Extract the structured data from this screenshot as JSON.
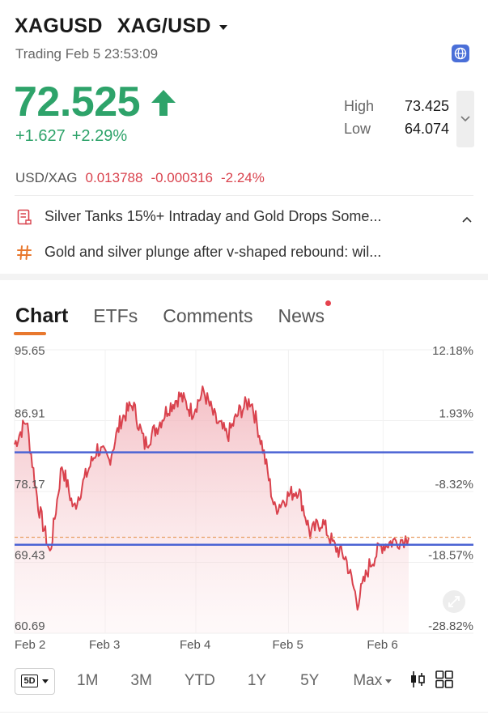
{
  "header": {
    "symbol": "XAGUSD",
    "pair": "XAG/USD",
    "status": "Trading Feb 5 23:53:09"
  },
  "quote": {
    "price": "72.525",
    "change": "+1.627",
    "change_pct": "+2.29%",
    "high_label": "High",
    "high": "73.425",
    "low_label": "Low",
    "low": "64.074"
  },
  "cross": {
    "label": "USD/XAG",
    "value": "0.013788",
    "change": "-0.000316",
    "change_pct": "-2.24%"
  },
  "news": [
    {
      "icon": "document-icon",
      "text": "Silver Tanks 15%+ Intraday and Gold Drops Some..."
    },
    {
      "icon": "hashtag-icon",
      "text": "Gold and silver plunge after v-shaped rebound: wil..."
    }
  ],
  "tabs": [
    {
      "label": "Chart",
      "active": true
    },
    {
      "label": "ETFs",
      "active": false
    },
    {
      "label": "Comments",
      "active": false
    },
    {
      "label": "News",
      "active": false,
      "dot": true
    }
  ],
  "chart_data": {
    "type": "area",
    "y_left_ticks": [
      "95.65",
      "86.91",
      "78.17",
      "69.43",
      "60.69"
    ],
    "y_right_ticks": [
      "12.18%",
      "1.93%",
      "-8.32%",
      "-18.57%",
      "-28.82%"
    ],
    "x_ticks": [
      "Feb 2",
      "Feb 3",
      "Feb 4",
      "Feb 5",
      "Feb 6"
    ],
    "ylim": [
      60.69,
      95.65
    ],
    "x": [
      0,
      0.03,
      0.06,
      0.09,
      0.12,
      0.15,
      0.18,
      0.21,
      0.24,
      0.27,
      0.3,
      0.33,
      0.36,
      0.39,
      0.42,
      0.45,
      0.48,
      0.51,
      0.54,
      0.57,
      0.6,
      0.63,
      0.66,
      0.69,
      0.72,
      0.75,
      0.78,
      0.81,
      0.84,
      0.87,
      0.9,
      0.93,
      0.96,
      1.0
    ],
    "values": [
      84.0,
      87.0,
      76.5,
      70.5,
      81.5,
      76.0,
      80.0,
      83.5,
      82.0,
      87.0,
      89.0,
      84.0,
      86.0,
      88.5,
      90.0,
      88.0,
      90.5,
      87.0,
      85.0,
      88.0,
      89.5,
      83.5,
      76.0,
      77.5,
      78.5,
      73.0,
      74.5,
      71.5,
      70.0,
      64.5,
      69.0,
      71.5,
      72.0,
      72.5
    ],
    "x_range_note": "",
    "hlines": [
      {
        "value": 83.0,
        "color": "#4b63d4"
      },
      {
        "value": 71.6,
        "color": "#4b63d4"
      }
    ],
    "last_price_line": 72.525,
    "line_color": "#d9424d",
    "fill_color": "#f4c7cc"
  },
  "ranges": {
    "selected": "5D",
    "items": [
      "1M",
      "3M",
      "YTD",
      "1Y",
      "5Y",
      "Max"
    ]
  },
  "colors": {
    "up": "#2ea36a",
    "down": "#d9424d",
    "accent": "#e8782e",
    "hline": "#4b63d4"
  }
}
